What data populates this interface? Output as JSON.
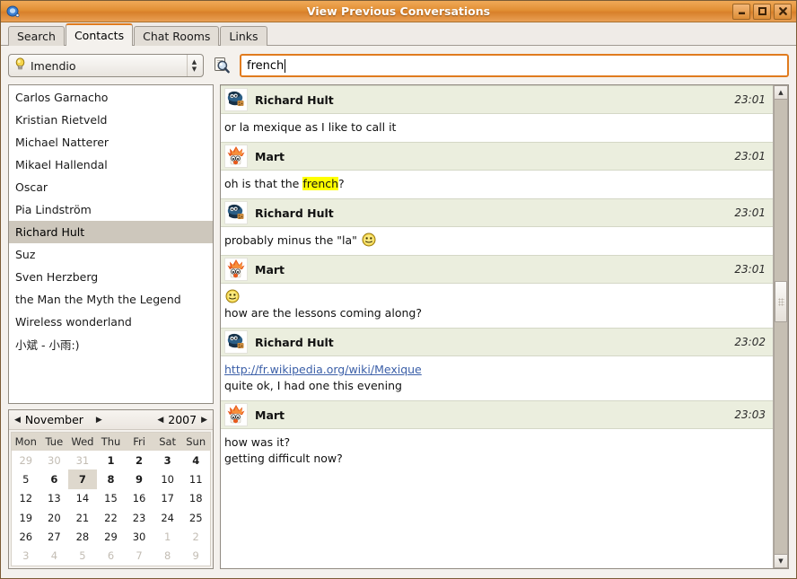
{
  "window": {
    "title": "View Previous Conversations",
    "icon": "chat-balloon-icon",
    "buttons": {
      "minimize": "minimize-icon",
      "maximize": "maximize-icon",
      "close": "close-icon"
    }
  },
  "tabs": [
    {
      "label": "Search",
      "active": false
    },
    {
      "label": "Contacts",
      "active": true
    },
    {
      "label": "Chat Rooms",
      "active": false
    },
    {
      "label": "Links",
      "active": false
    }
  ],
  "toolbar": {
    "account": {
      "icon": "lightbulb-icon",
      "value": "Imendio"
    },
    "search_icon": "search-magnifier-icon",
    "search_value": "french",
    "search_placeholder": ""
  },
  "contacts": [
    {
      "name": "Carlos Garnacho",
      "selected": false
    },
    {
      "name": "Kristian Rietveld",
      "selected": false
    },
    {
      "name": "Michael Natterer",
      "selected": false
    },
    {
      "name": "Mikael Hallendal",
      "selected": false
    },
    {
      "name": "Oscar",
      "selected": false
    },
    {
      "name": "Pia Lindström",
      "selected": false
    },
    {
      "name": "Richard Hult",
      "selected": true
    },
    {
      "name": "Suz",
      "selected": false
    },
    {
      "name": "Sven Herzberg",
      "selected": false
    },
    {
      "name": "the Man the Myth the Legend",
      "selected": false
    },
    {
      "name": "Wireless wonderland",
      "selected": false
    },
    {
      "name": "小斌 - 小雨:)",
      "selected": false
    }
  ],
  "calendar": {
    "month": "November",
    "year": "2007",
    "prev_month_label": "◀",
    "next_month_label": "▶",
    "prev_year_label": "◀",
    "next_year_label": "▶",
    "day_names": [
      "Mon",
      "Tue",
      "Wed",
      "Thu",
      "Fri",
      "Sat",
      "Sun"
    ],
    "weeks": [
      [
        {
          "d": "29",
          "dim": true,
          "bold": false,
          "selected": false
        },
        {
          "d": "30",
          "dim": true,
          "bold": false,
          "selected": false
        },
        {
          "d": "31",
          "dim": true,
          "bold": false,
          "selected": false
        },
        {
          "d": "1",
          "dim": false,
          "bold": true,
          "selected": false
        },
        {
          "d": "2",
          "dim": false,
          "bold": true,
          "selected": false
        },
        {
          "d": "3",
          "dim": false,
          "bold": true,
          "selected": false
        },
        {
          "d": "4",
          "dim": false,
          "bold": true,
          "selected": false
        }
      ],
      [
        {
          "d": "5",
          "dim": false,
          "bold": false,
          "selected": false
        },
        {
          "d": "6",
          "dim": false,
          "bold": true,
          "selected": false
        },
        {
          "d": "7",
          "dim": false,
          "bold": true,
          "selected": true
        },
        {
          "d": "8",
          "dim": false,
          "bold": true,
          "selected": false
        },
        {
          "d": "9",
          "dim": false,
          "bold": true,
          "selected": false
        },
        {
          "d": "10",
          "dim": false,
          "bold": false,
          "selected": false
        },
        {
          "d": "11",
          "dim": false,
          "bold": false,
          "selected": false
        }
      ],
      [
        {
          "d": "12",
          "dim": false,
          "bold": false,
          "selected": false
        },
        {
          "d": "13",
          "dim": false,
          "bold": false,
          "selected": false
        },
        {
          "d": "14",
          "dim": false,
          "bold": false,
          "selected": false
        },
        {
          "d": "15",
          "dim": false,
          "bold": false,
          "selected": false
        },
        {
          "d": "16",
          "dim": false,
          "bold": false,
          "selected": false
        },
        {
          "d": "17",
          "dim": false,
          "bold": false,
          "selected": false
        },
        {
          "d": "18",
          "dim": false,
          "bold": false,
          "selected": false
        }
      ],
      [
        {
          "d": "19",
          "dim": false,
          "bold": false,
          "selected": false
        },
        {
          "d": "20",
          "dim": false,
          "bold": false,
          "selected": false
        },
        {
          "d": "21",
          "dim": false,
          "bold": false,
          "selected": false
        },
        {
          "d": "22",
          "dim": false,
          "bold": false,
          "selected": false
        },
        {
          "d": "23",
          "dim": false,
          "bold": false,
          "selected": false
        },
        {
          "d": "24",
          "dim": false,
          "bold": false,
          "selected": false
        },
        {
          "d": "25",
          "dim": false,
          "bold": false,
          "selected": false
        }
      ],
      [
        {
          "d": "26",
          "dim": false,
          "bold": false,
          "selected": false
        },
        {
          "d": "27",
          "dim": false,
          "bold": false,
          "selected": false
        },
        {
          "d": "28",
          "dim": false,
          "bold": false,
          "selected": false
        },
        {
          "d": "29",
          "dim": false,
          "bold": false,
          "selected": false
        },
        {
          "d": "30",
          "dim": false,
          "bold": false,
          "selected": false
        },
        {
          "d": "1",
          "dim": true,
          "bold": false,
          "selected": false
        },
        {
          "d": "2",
          "dim": true,
          "bold": false,
          "selected": false
        }
      ],
      [
        {
          "d": "3",
          "dim": true,
          "bold": false,
          "selected": false
        },
        {
          "d": "4",
          "dim": true,
          "bold": false,
          "selected": false
        },
        {
          "d": "5",
          "dim": true,
          "bold": false,
          "selected": false
        },
        {
          "d": "6",
          "dim": true,
          "bold": false,
          "selected": false
        },
        {
          "d": "7",
          "dim": true,
          "bold": false,
          "selected": false
        },
        {
          "d": "8",
          "dim": true,
          "bold": false,
          "selected": false
        },
        {
          "d": "9",
          "dim": true,
          "bold": false,
          "selected": false
        }
      ]
    ]
  },
  "conversation": [
    {
      "sender": "Richard Hult",
      "avatar": "cookie-monster-avatar",
      "time": "23:01",
      "lines": [
        {
          "parts": [
            {
              "t": "or la mexique as I like to call it",
              "k": "text"
            }
          ]
        }
      ]
    },
    {
      "sender": "Mart",
      "avatar": "beaker-avatar",
      "time": "23:01",
      "lines": [
        {
          "parts": [
            {
              "t": "oh is that the ",
              "k": "text"
            },
            {
              "t": "french",
              "k": "highlight"
            },
            {
              "t": "?",
              "k": "text"
            }
          ]
        }
      ]
    },
    {
      "sender": "Richard Hult",
      "avatar": "cookie-monster-avatar",
      "time": "23:01",
      "lines": [
        {
          "parts": [
            {
              "t": "probably minus the \"la\" ",
              "k": "text"
            },
            {
              "t": "",
              "k": "smiley"
            }
          ]
        }
      ]
    },
    {
      "sender": "Mart",
      "avatar": "beaker-avatar",
      "time": "23:01",
      "lines": [
        {
          "parts": [
            {
              "t": "",
              "k": "smiley"
            }
          ]
        },
        {
          "parts": [
            {
              "t": "how are the lessons coming along?",
              "k": "text"
            }
          ]
        }
      ]
    },
    {
      "sender": "Richard Hult",
      "avatar": "cookie-monster-avatar",
      "time": "23:02",
      "lines": [
        {
          "parts": [
            {
              "t": "http://fr.wikipedia.org/wiki/Mexique",
              "k": "link"
            }
          ]
        },
        {
          "parts": [
            {
              "t": "quite ok, I had one this evening",
              "k": "text"
            }
          ]
        }
      ]
    },
    {
      "sender": "Mart",
      "avatar": "beaker-avatar",
      "time": "23:03",
      "lines": [
        {
          "parts": [
            {
              "t": "how was it?",
              "k": "text"
            }
          ]
        },
        {
          "parts": [
            {
              "t": "getting difficult now?",
              "k": "text"
            }
          ]
        }
      ]
    }
  ],
  "scrollbar": {
    "up_arrow": "▲",
    "down_arrow": "▼",
    "thumb_top_pct": 40,
    "thumb_height_pct": 9
  },
  "colors": {
    "titlebar": "#e28f34",
    "accent": "#e07b1e",
    "msg_header_bg": "#ebeede",
    "selection": "#cdc7bc",
    "highlight": "#ffff00",
    "link": "#3b5fa8"
  }
}
